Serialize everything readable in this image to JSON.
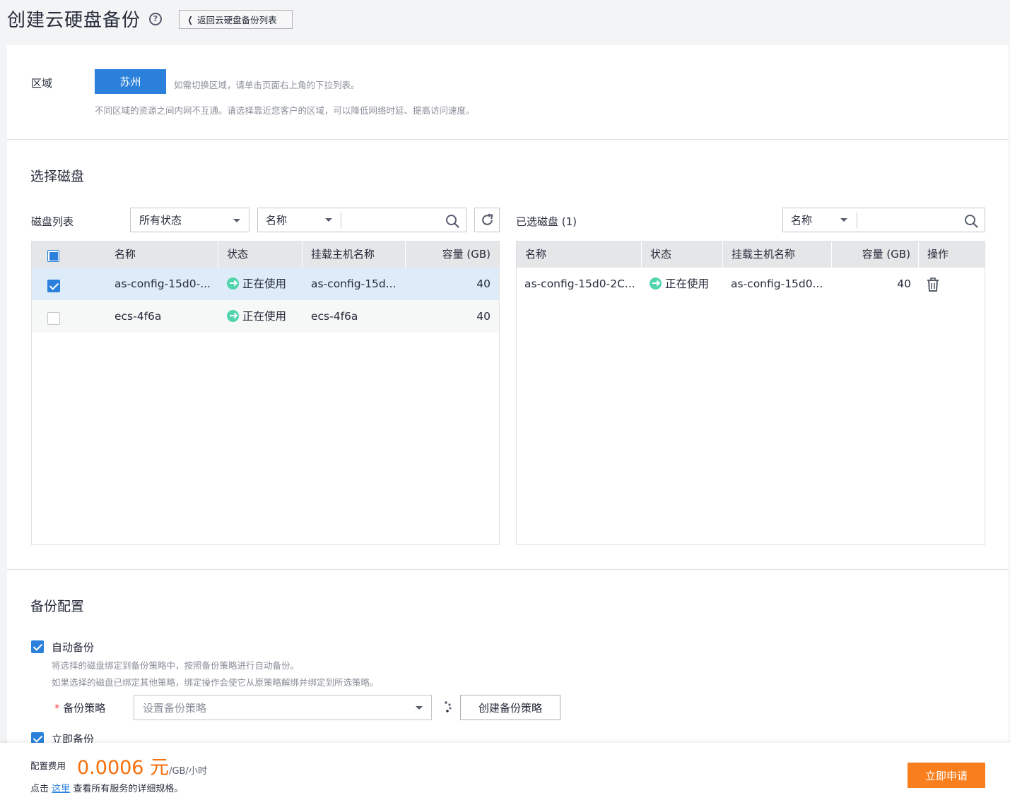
{
  "header": {
    "title": "创建云硬盘备份",
    "back_label": "返回云硬盘备份列表"
  },
  "region": {
    "label": "区域",
    "selected": "苏州",
    "switch_hint": "如需切换区域，请单击页面右上角的下拉列表。",
    "note": "不同区域的资源之间内网不互通。请选择靠近您客户的区域，可以降低网络时延、提高访问速度。"
  },
  "disk_select": {
    "section_title": "选择磁盘",
    "list_label": "磁盘列表",
    "status_filter": "所有状态",
    "search_field": "名称",
    "search_value": "",
    "columns": [
      "名称",
      "状态",
      "挂载主机名称",
      "容量 (GB)"
    ],
    "rows": [
      {
        "name": "as-config-15d0-...",
        "status": "正在使用",
        "host": "as-config-15d...",
        "capacity": "40",
        "checked": true
      },
      {
        "name": "ecs-4f6a",
        "status": "正在使用",
        "host": "ecs-4f6a",
        "capacity": "40",
        "checked": false
      }
    ]
  },
  "selected_disks": {
    "label": "已选磁盘 (1)",
    "search_field": "名称",
    "search_value": "",
    "columns": [
      "名称",
      "状态",
      "挂载主机名称",
      "容量 (GB)",
      "操作"
    ],
    "rows": [
      {
        "name": "as-config-15d0-2C...",
        "status": "正在使用",
        "host": "as-config-15d0...",
        "capacity": "40"
      }
    ]
  },
  "backup_config": {
    "section_title": "备份配置",
    "auto_backup_label": "自动备份",
    "auto_backup_checked": true,
    "auto_hint_1": "将选择的磁盘绑定到备份策略中，按照备份策略进行自动备份。",
    "auto_hint_2": "如果选择的磁盘已绑定其他策略，绑定操作会使它从原策略解绑并绑定到所选策略。",
    "policy_required_mark": "*",
    "policy_label": "备份策略",
    "policy_placeholder": "设置备份策略",
    "create_policy_label": "创建备份策略",
    "immediate_backup_label": "立即备份",
    "immediate_backup_checked": true
  },
  "footer": {
    "fee_label": "配置费用",
    "price": "0.0006 元",
    "price_unit": "/GB/小时",
    "detail_prefix": "点击",
    "detail_link": "这里",
    "detail_suffix": "查看所有服务的详细规格。",
    "apply_label": "立即申请"
  },
  "colors": {
    "primary": "#2a80db",
    "accent": "#f97e1d",
    "price": "#f66f0c",
    "status_ok": "#50d4ab"
  }
}
